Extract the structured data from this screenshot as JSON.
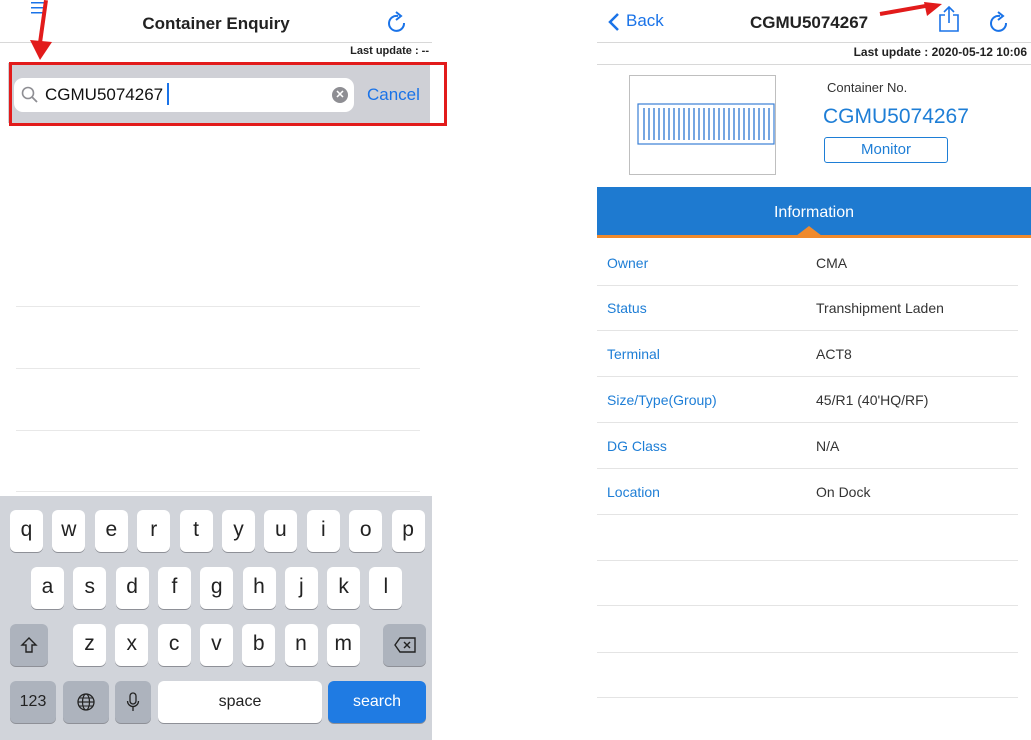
{
  "left": {
    "title": "Container Enquiry",
    "last_update": "Last update : --",
    "search_value": "CGMU5074267",
    "cancel_label": "Cancel"
  },
  "keyboard": {
    "row1": [
      "q",
      "w",
      "e",
      "r",
      "t",
      "y",
      "u",
      "i",
      "o",
      "p"
    ],
    "row2": [
      "a",
      "s",
      "d",
      "f",
      "g",
      "h",
      "j",
      "k",
      "l"
    ],
    "row3": [
      "z",
      "x",
      "c",
      "v",
      "b",
      "n",
      "m"
    ],
    "numbers_label": "123",
    "space_label": "space",
    "search_label": "search"
  },
  "right": {
    "back_label": "Back",
    "title": "CGMU5074267",
    "last_update": "Last update : 2020-05-12 10:06",
    "container_no_label": "Container No.",
    "container_no_value": "CGMU5074267",
    "monitor_label": "Monitor",
    "tab_label": "Information",
    "rows": [
      {
        "label": "Owner",
        "value": "CMA"
      },
      {
        "label": "Status",
        "value": "Transhipment Laden"
      },
      {
        "label": "Terminal",
        "value": "ACT8"
      },
      {
        "label": "Size/Type(Group)",
        "value": "45/R1 (40'HQ/RF)"
      },
      {
        "label": "DG Class",
        "value": "N/A"
      },
      {
        "label": "Location",
        "value": "On Dock"
      }
    ]
  },
  "colors": {
    "accent": "#1e7ad0",
    "highlight": "#e21b1b",
    "tab_indicator": "#f08a2c"
  }
}
